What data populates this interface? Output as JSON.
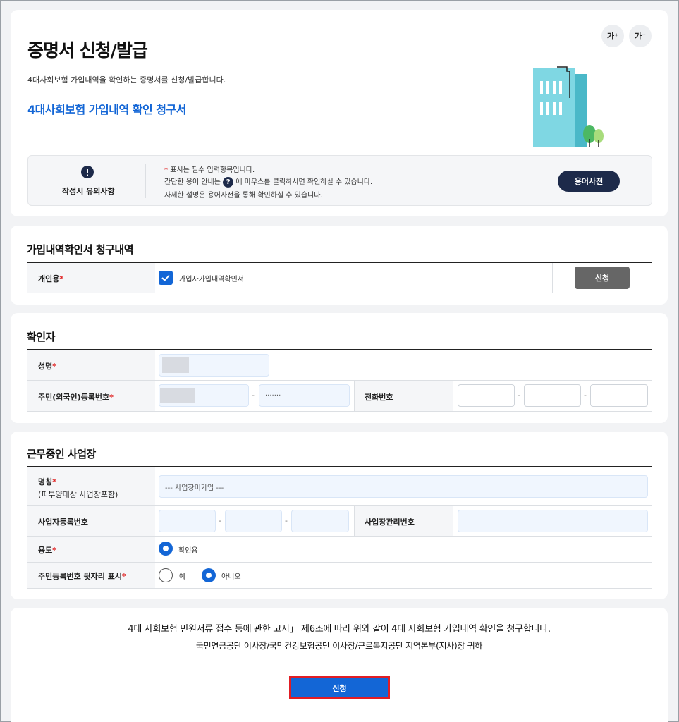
{
  "header": {
    "title": "증명서 신청/발급",
    "description": "4대사회보험 가입내역을 확인하는 증명서를 신청/발급합니다.",
    "doc_title": "4대사회보험 가입내역 확인 청구서",
    "font_increase": "가⁺",
    "font_decrease": "가⁻"
  },
  "notice": {
    "title": "작성시 유의사항",
    "required_mark": "*",
    "line1": "표시는 필수 입력항목입니다.",
    "line2_before": "간단한 용어 안내는",
    "line2_icon": "?",
    "line2_after": "에 마우스를 클릭하시면 확인하실 수 있습니다.",
    "line3": "자세한 설명은 용어사전을 통해 확인하실 수 있습니다.",
    "dict_button": "용어사전"
  },
  "request": {
    "section_title": "가입내역확인서 청구내역",
    "label": "개인용",
    "required": "*",
    "checkbox_label": "가입자가입내역확인서",
    "checked": true,
    "apply_button": "신청"
  },
  "verifier": {
    "section_title": "확인자",
    "name_label": "성명",
    "rrn_label": "주민(외국인)등록번호",
    "rrn_back": "·······",
    "phone_label": "전화번호",
    "dash": "-",
    "required": "*"
  },
  "workplace": {
    "section_title": "근무중인 사업장",
    "name_label": "명칭",
    "name_sub": "(피부양대상 사업장포함)",
    "name_value": "--- 사업장미가입 ---",
    "biz_no_label": "사업자등록번호",
    "mgmt_no_label": "사업장관리번호",
    "purpose_label": "용도",
    "purpose_option": "확인용",
    "rrn_display_label": "주민등록번호 뒷자리 표시",
    "yes": "예",
    "no": "아니오",
    "selected": "아니오",
    "dash": "-",
    "required": "*"
  },
  "footer": {
    "statement": "4대 사회보험 민원서류 접수 등에 관한 고시」 제6조에 따라 위와 같이 4대 사회보험 가입내역 확인을 청구합니다.",
    "addressee": "국민연금공단 이사장/국민건강보험공단 이사장/근로복지공단 지역본부(지사)장 귀하",
    "submit_button": "신청"
  },
  "colors": {
    "accent": "#1366d6",
    "navy": "#1d2a4a",
    "required": "#e02020",
    "highlight_border": "#e11d24"
  }
}
